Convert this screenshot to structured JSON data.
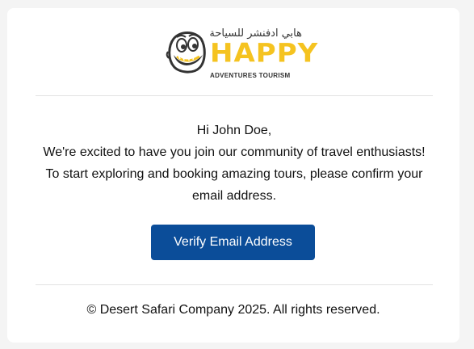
{
  "brand": {
    "arabic_name": "هابي ادفنشر للسياحة",
    "wordmark": "HAPPY",
    "tagline": "ADVENTURES TOURISM",
    "wordmark_color": "#f5c320",
    "mascot_icon": "smiling-face-mascot"
  },
  "email": {
    "greeting": "Hi John Doe,",
    "body": "We're excited to have you join our community of travel enthusiasts! To start exploring and booking amazing tours, please confirm your email address."
  },
  "cta": {
    "label": "Verify Email Address",
    "color": "#0b4d99"
  },
  "footer": {
    "copyright": "© Desert Safari Company 2025. All rights reserved."
  }
}
